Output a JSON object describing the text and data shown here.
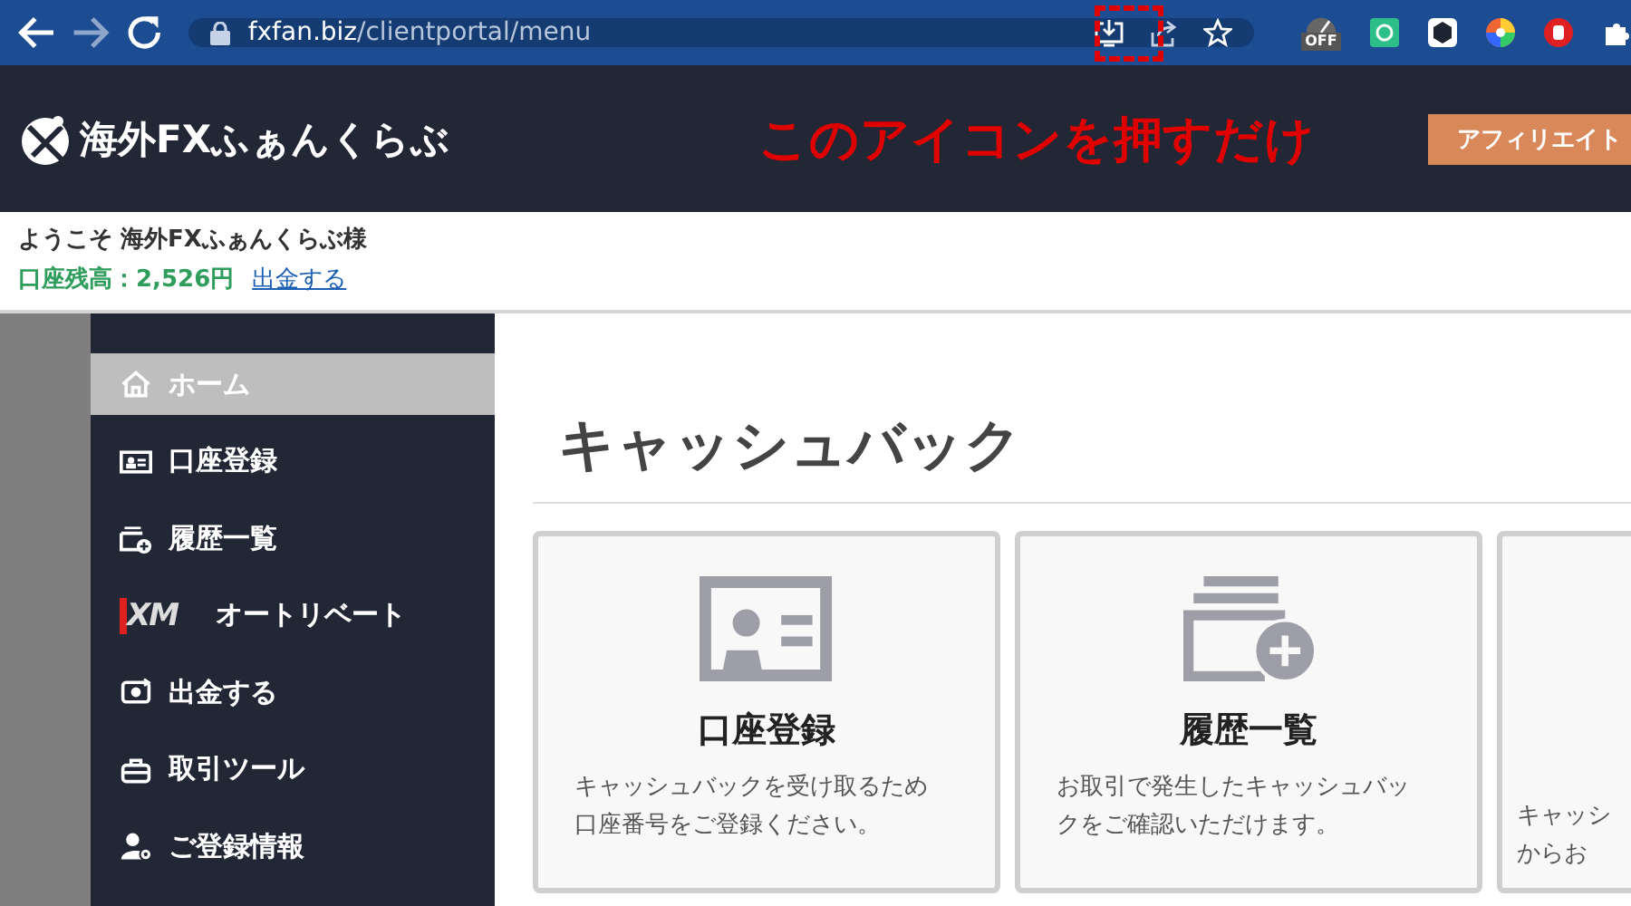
{
  "browser": {
    "url_host": "fxfan.biz",
    "url_path": "/clientportal/menu",
    "extensions": [
      {
        "kind": "off-badge",
        "label": "OFF"
      },
      {
        "kind": "green-square"
      },
      {
        "kind": "dark-hex"
      },
      {
        "kind": "color-wheel"
      },
      {
        "kind": "red-hand"
      },
      {
        "kind": "puzzle"
      }
    ]
  },
  "annotation": {
    "text": "このアイコンを押すだけ"
  },
  "header": {
    "logo_text": "海外FXふぁんくらぶ",
    "button": "アフィリエイト"
  },
  "account": {
    "greeting": "ようこそ 海外FXふぁんくらぶ様",
    "balance": "口座残高：2,526円",
    "withdraw_link": "出金する"
  },
  "sidebar": {
    "items": [
      {
        "kind": "home",
        "label": "ホーム",
        "selected": true
      },
      {
        "kind": "id-card",
        "label": "口座登録",
        "selected": false
      },
      {
        "kind": "history",
        "label": "履歴一覧",
        "selected": false
      },
      {
        "kind": "xm",
        "icon_text": "XM",
        "label": "オートリベート",
        "selected": false
      },
      {
        "kind": "money",
        "label": "出金する",
        "selected": false
      },
      {
        "kind": "toolbox",
        "label": "取引ツール",
        "selected": false
      },
      {
        "kind": "user-gear",
        "label": "ご登録情報",
        "selected": false
      }
    ]
  },
  "main": {
    "title": "キャッシュバック",
    "cards": [
      {
        "kind": "id-card",
        "title": "口座登録",
        "description_lines": [
          "キャッシュバックを受け取るため",
          "口座番号をご登録ください。"
        ]
      },
      {
        "kind": "history",
        "title": "履歴一覧",
        "description_lines": [
          "お取引で発生したキャッシュバッ",
          "クをご確認いただけます。"
        ]
      },
      {
        "kind": "unknown",
        "description_lines": [
          "キャッシ",
          "からお"
        ]
      }
    ]
  }
}
